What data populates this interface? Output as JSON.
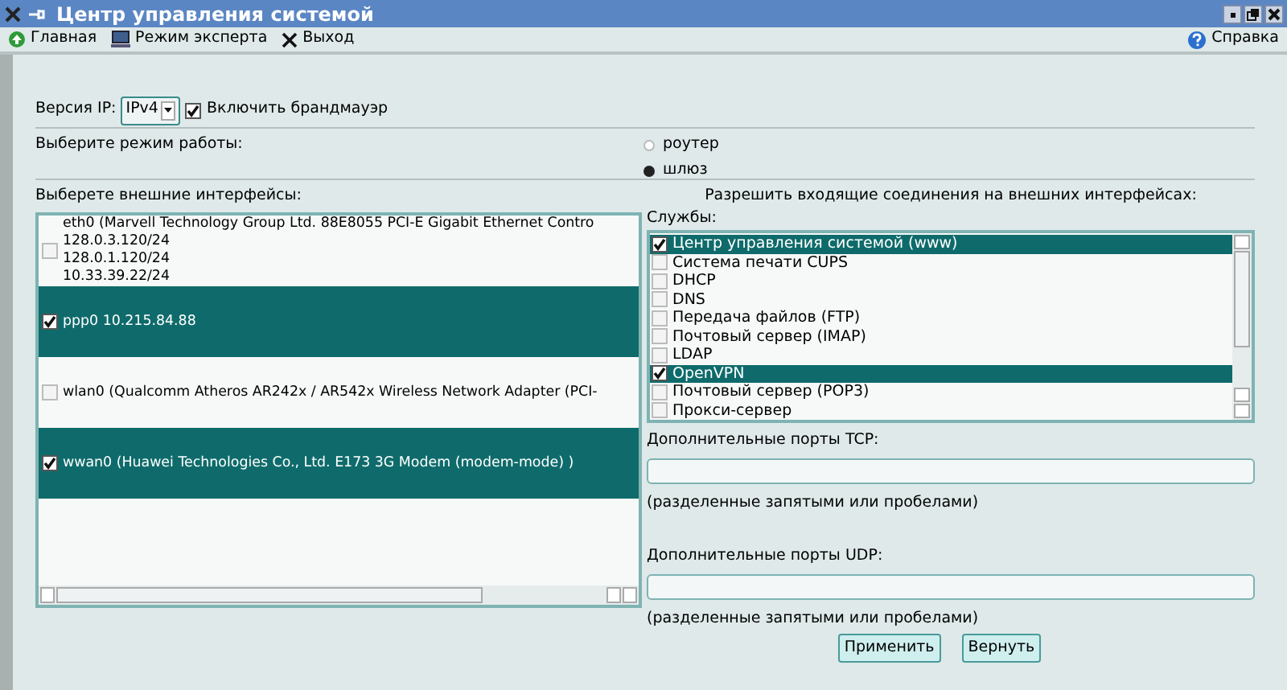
{
  "window": {
    "title": "Центр управления системой"
  },
  "toolbar": {
    "left": [
      {
        "label": "Главная",
        "kind": "home"
      },
      {
        "label": "Режим эксперта",
        "kind": "expert"
      },
      {
        "label": "Выход",
        "kind": "exit"
      }
    ],
    "help": {
      "label": "Справка"
    }
  },
  "ip": {
    "label": "Версия IP:",
    "value": "IPv4",
    "firewall": {
      "label": "Включить брандмауэр",
      "checked": true
    }
  },
  "mode": {
    "label": "Выберите режим работы:",
    "options": [
      {
        "label": "роутер",
        "selected": false
      },
      {
        "label": "шлюз",
        "selected": true
      }
    ]
  },
  "interfaces": {
    "label": "Выберете внешние интерфейсы:",
    "items": [
      {
        "lines": [
          "eth0 (Marvell Technology Group Ltd. 88E8055 PCI-E Gigabit Ethernet Contro",
          "128.0.3.120/24",
          "128.0.1.120/24",
          "10.33.39.22/24"
        ],
        "checked": false,
        "selected": false
      },
      {
        "lines": [
          "ppp0 10.215.84.88"
        ],
        "checked": true,
        "selected": true
      },
      {
        "lines": [
          "wlan0 (Qualcomm Atheros AR242x / AR542x Wireless Network Adapter (PCI-"
        ],
        "checked": false,
        "selected": false
      },
      {
        "lines": [
          "wwan0 (Huawei Technologies Co., Ltd. E173 3G Modem (modem-mode) )"
        ],
        "checked": true,
        "selected": true
      }
    ]
  },
  "incoming": {
    "heading": "Разрешить входящие соединения на внешних интерфейсах:",
    "services_label": "Службы:",
    "services": [
      {
        "label": "Центр управления системой (www)",
        "checked": true
      },
      {
        "label": "Система печати CUPS",
        "checked": false
      },
      {
        "label": "DHCP",
        "checked": false
      },
      {
        "label": "DNS",
        "checked": false
      },
      {
        "label": "Передача файлов (FTP)",
        "checked": false
      },
      {
        "label": "Почтовый сервер (IMAP)",
        "checked": false
      },
      {
        "label": "LDAP",
        "checked": false
      },
      {
        "label": "OpenVPN",
        "checked": true
      },
      {
        "label": "Почтовый сервер (POP3)",
        "checked": false
      },
      {
        "label": "Прокси-сервер",
        "checked": false
      }
    ],
    "tcp": {
      "label": "Дополнительные порты TCP:",
      "hint": "(разделенные запятыми или пробелами)"
    },
    "udp": {
      "label": "Дополнительные порты UDP:",
      "hint": "(разделенные запятыми или пробелами)"
    }
  },
  "buttons": [
    "Применить",
    "Вернуть"
  ]
}
